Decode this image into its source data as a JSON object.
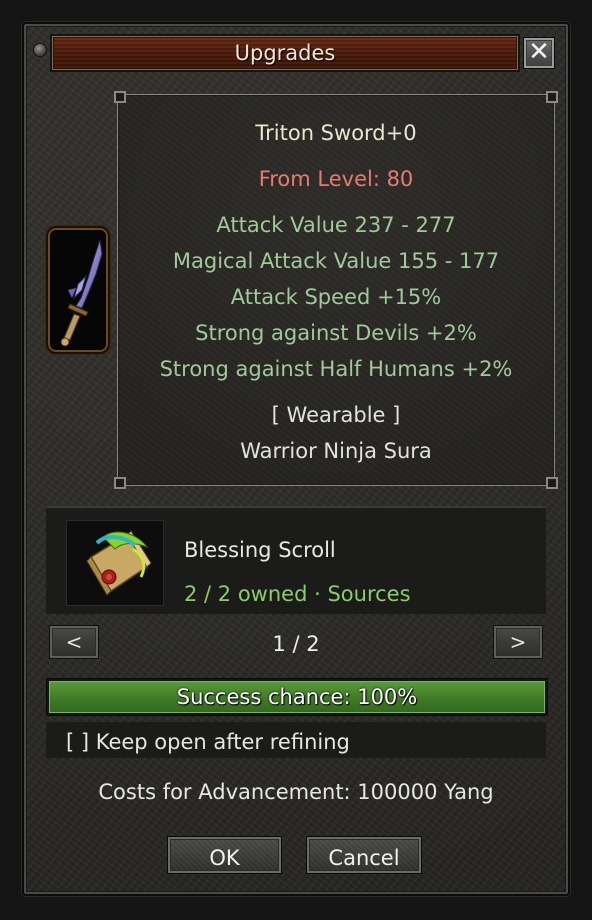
{
  "window": {
    "title": "Upgrades",
    "close_label": "✕"
  },
  "item": {
    "name": "Triton Sword+0",
    "level_req": "From Level: 80",
    "attributes": [
      "Attack Value 237 - 277",
      "Magical Attack Value 155 - 177",
      "Attack Speed +15%",
      "Strong against Devils +2%",
      "Strong against Half Humans +2%"
    ],
    "wearable": "[ Wearable ]",
    "classes": "Warrior Ninja Sura",
    "icon": "sword-icon"
  },
  "material": {
    "icon": "blessing-scroll-icon",
    "name": "Blessing Scroll",
    "owned": "2 / 2 owned",
    "separator": "·",
    "sources_label": "Sources"
  },
  "pager": {
    "prev_label": "<",
    "next_label": ">",
    "indicator": "1 / 2"
  },
  "success": {
    "label": "Success chance: 100%",
    "value": 1.0
  },
  "keep_open": {
    "label": "[ ] Keep open after refining"
  },
  "costs": {
    "label": "Costs for Advancement: 100000 Yang"
  },
  "buttons": {
    "ok_label": "OK",
    "cancel_label": "Cancel"
  },
  "colors": {
    "title_bar": "#5a2210",
    "item_name": "#ece6cf",
    "requirement": "#e87a72",
    "attribute": "#a2c99a",
    "owned": "#8ccc6a",
    "success_fill": "#4a8a2e"
  }
}
